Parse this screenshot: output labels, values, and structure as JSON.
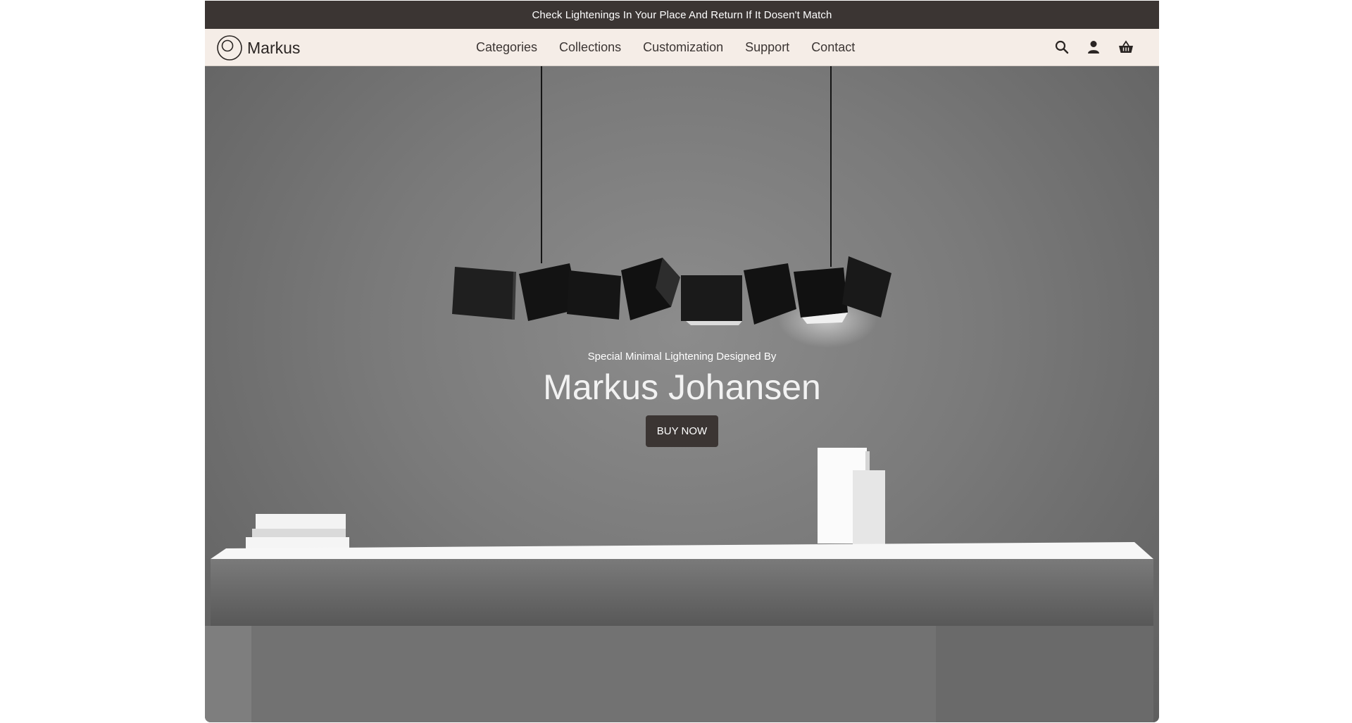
{
  "announcement": "Check Lightenings In Your Place And Return If It Dosen't Match",
  "brand": {
    "name": "Markus"
  },
  "nav": {
    "items": [
      "Categories",
      "Collections",
      "Customization",
      "Support",
      "Contact"
    ]
  },
  "header_icons": [
    "search-icon",
    "user-icon",
    "basket-icon"
  ],
  "hero": {
    "subtitle": "Special Minimal Lightening Designed By",
    "title": "Markus Johansen",
    "cta": "BUY NOW"
  },
  "colors": {
    "topbar": "#3b3533",
    "nav_bg": "#f5ede7",
    "button": "#3b3533"
  }
}
